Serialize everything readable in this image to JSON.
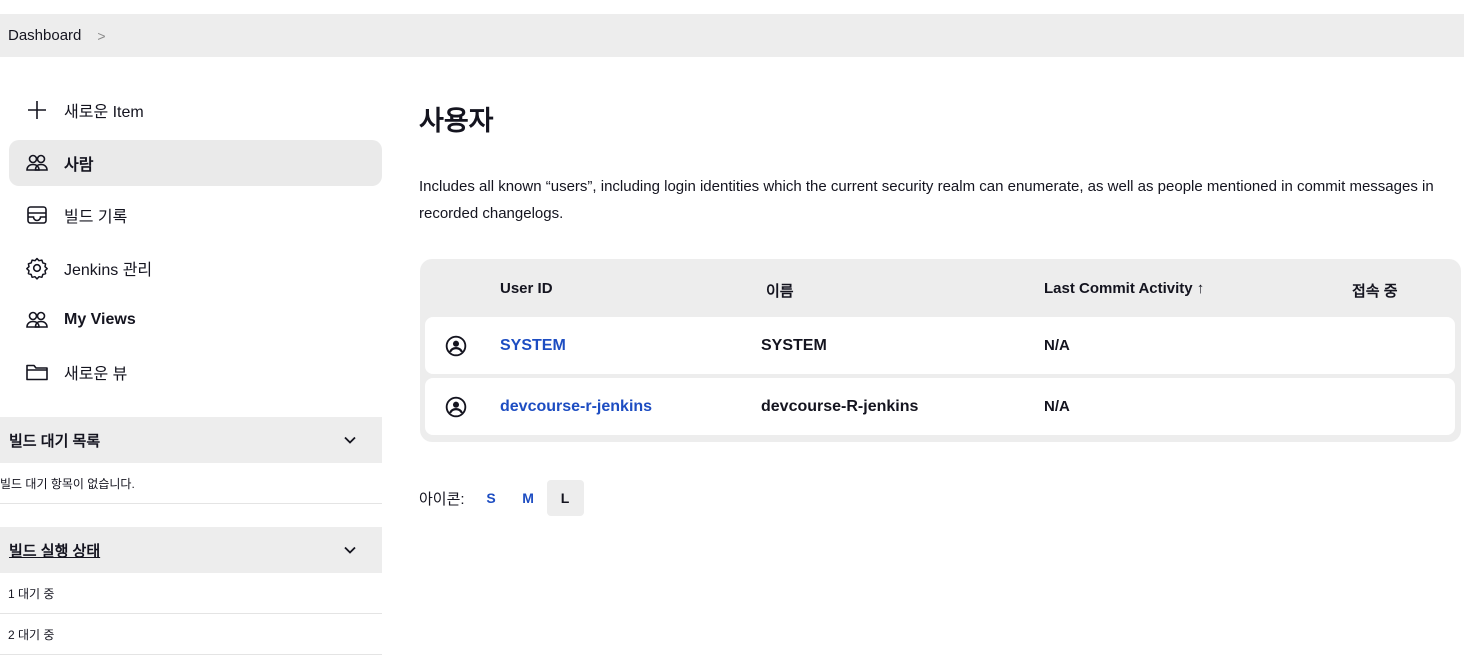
{
  "breadcrumb": {
    "items": [
      "Dashboard"
    ]
  },
  "sidebar": {
    "tasks": [
      {
        "label": "새로운 Item",
        "icon": "plus-icon"
      },
      {
        "label": "사람",
        "icon": "people-icon",
        "active": true
      },
      {
        "label": "빌드 기록",
        "icon": "build-history-icon"
      },
      {
        "label": "Jenkins 관리",
        "icon": "gear-icon"
      },
      {
        "label": "My Views",
        "icon": "people-icon"
      },
      {
        "label": "새로운 뷰",
        "icon": "folder-icon"
      }
    ],
    "build_queue": {
      "title": "빌드 대기 목록",
      "empty_text": "빌드 대기 항목이 없습니다."
    },
    "executors": {
      "title": "빌드 실행 상태",
      "rows": [
        "1 대기 중",
        "2 대기 중"
      ]
    }
  },
  "main": {
    "title": "사용자",
    "description": "Includes all known “users”, including login identities which the current security realm can enumerate, as well as people mentioned in commit messages in recorded changelogs.",
    "table": {
      "headers": {
        "user_id": "User ID",
        "name": "이름",
        "last_commit": "Last Commit Activity ↑",
        "online": "접속 중"
      },
      "rows": [
        {
          "user_id": "SYSTEM",
          "name": "SYSTEM",
          "last_commit": "N/A",
          "online": ""
        },
        {
          "user_id": "devcourse-r-jenkins",
          "name": "devcourse-R-jenkins",
          "last_commit": "N/A",
          "online": ""
        }
      ]
    },
    "icon_size": {
      "label": "아이콘:",
      "options": [
        "S",
        "M",
        "L"
      ],
      "selected": "L"
    }
  },
  "colors": {
    "link": "#1d4dc2",
    "panel_bg": "#ededed",
    "text": "#14141f"
  }
}
